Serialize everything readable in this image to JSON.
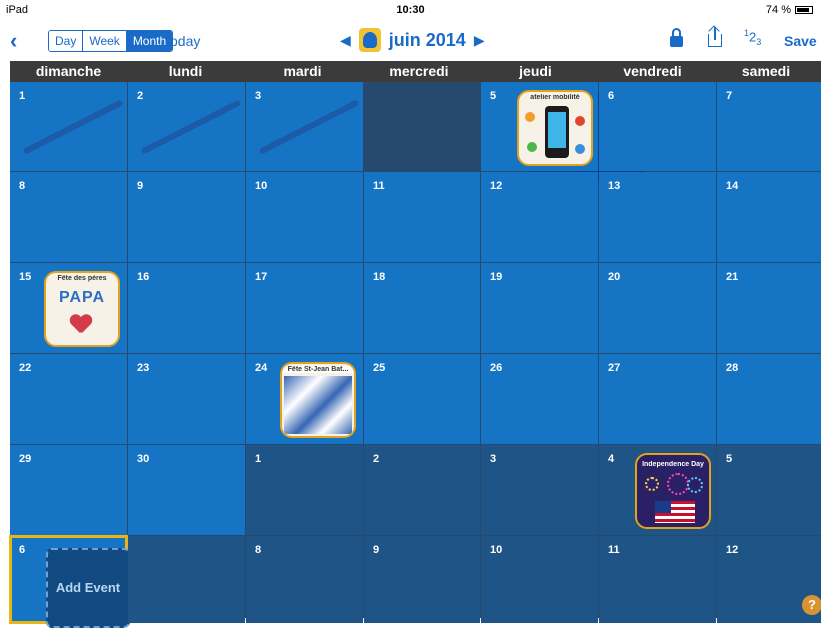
{
  "statusbar": {
    "device": "iPad",
    "time": "10:30",
    "battery": "74 %"
  },
  "toolbar": {
    "views": [
      "Day",
      "Week",
      "Month"
    ],
    "active_view": "Month",
    "today_label": "Today",
    "month_title": "juin 2014",
    "save_label": "Save",
    "numbers_label": "123"
  },
  "weekdays": [
    "dimanche",
    "lundi",
    "mardi",
    "mercredi",
    "jeudi",
    "vendredi",
    "samedi"
  ],
  "days": [
    {
      "n": "1"
    },
    {
      "n": "2"
    },
    {
      "n": "3"
    },
    {
      "n": "4"
    },
    {
      "n": "5"
    },
    {
      "n": "6"
    },
    {
      "n": "7"
    },
    {
      "n": "8"
    },
    {
      "n": "9"
    },
    {
      "n": "10"
    },
    {
      "n": "11"
    },
    {
      "n": "12"
    },
    {
      "n": "13"
    },
    {
      "n": "14"
    },
    {
      "n": "15"
    },
    {
      "n": "16"
    },
    {
      "n": "17"
    },
    {
      "n": "18"
    },
    {
      "n": "19"
    },
    {
      "n": "20"
    },
    {
      "n": "21"
    },
    {
      "n": "22"
    },
    {
      "n": "23"
    },
    {
      "n": "24"
    },
    {
      "n": "25"
    },
    {
      "n": "26"
    },
    {
      "n": "27"
    },
    {
      "n": "28"
    },
    {
      "n": "29"
    },
    {
      "n": "30"
    },
    {
      "n": "1"
    },
    {
      "n": "2"
    },
    {
      "n": "3"
    },
    {
      "n": "4"
    },
    {
      "n": "5"
    },
    {
      "n": "6"
    },
    {
      "n": ""
    },
    {
      "n": "8"
    },
    {
      "n": "9"
    },
    {
      "n": "10"
    },
    {
      "n": "11"
    },
    {
      "n": "12"
    }
  ],
  "events": {
    "atelier": "atelier mobilité",
    "fete_peres": "Fête des pères",
    "papa": "PAPA",
    "st_jean": "Fête St-Jean Bat...",
    "independence": "Independence Day"
  },
  "add_event_label": "Add Event",
  "help_label": "?",
  "colors": {
    "accent": "#1a6bc7",
    "cell": "#1574c4",
    "other_month": "#1f5486",
    "today_badge": "#f4c21b"
  }
}
